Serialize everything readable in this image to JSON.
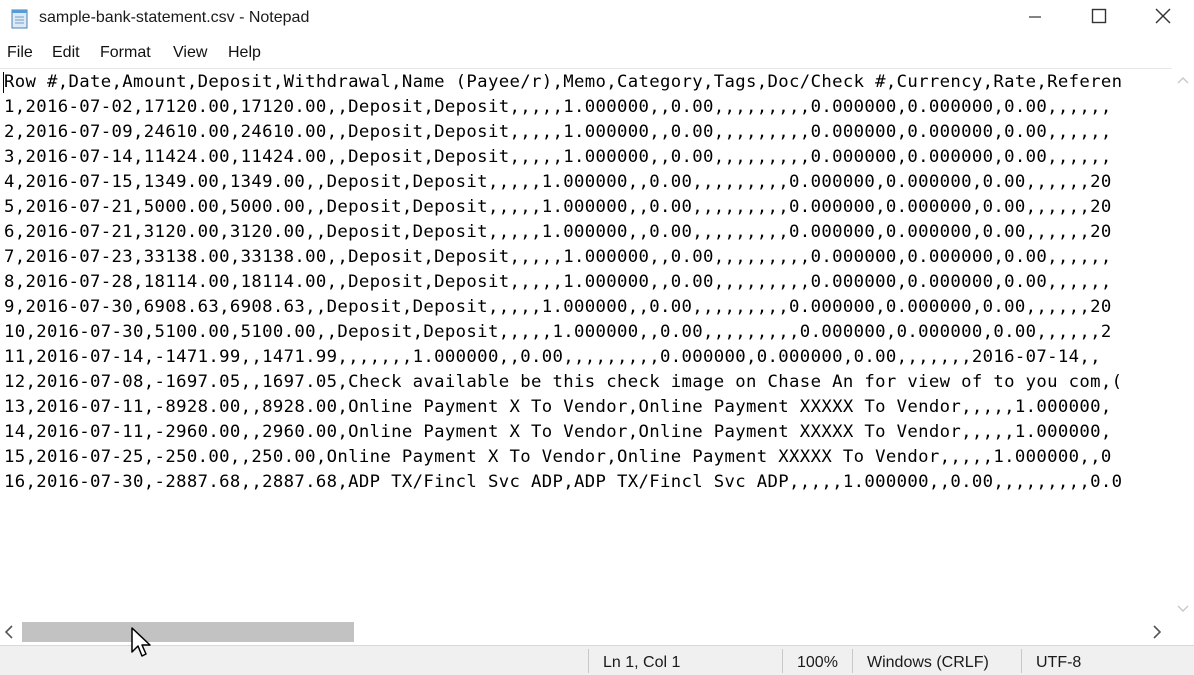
{
  "window": {
    "title": "sample-bank-statement.csv - Notepad",
    "app_icon": "notepad-icon",
    "controls": {
      "minimize": "minimize-icon",
      "maximize": "maximize-icon",
      "close": "close-icon"
    }
  },
  "menu": [
    "File",
    "Edit",
    "Format",
    "View",
    "Help"
  ],
  "editor": {
    "lines": [
      "Row #,Date,Amount,Deposit,Withdrawal,Name (Payee/r),Memo,Category,Tags,Doc/Check #,Currency,Rate,Referen",
      "1,2016-07-02,17120.00,17120.00,,Deposit,Deposit,,,,,1.000000,,0.00,,,,,,,,,0.000000,0.000000,0.00,,,,,,",
      "2,2016-07-09,24610.00,24610.00,,Deposit,Deposit,,,,,1.000000,,0.00,,,,,,,,,0.000000,0.000000,0.00,,,,,,",
      "3,2016-07-14,11424.00,11424.00,,Deposit,Deposit,,,,,1.000000,,0.00,,,,,,,,,0.000000,0.000000,0.00,,,,,,",
      "4,2016-07-15,1349.00,1349.00,,Deposit,Deposit,,,,,1.000000,,0.00,,,,,,,,,0.000000,0.000000,0.00,,,,,,20",
      "5,2016-07-21,5000.00,5000.00,,Deposit,Deposit,,,,,1.000000,,0.00,,,,,,,,,0.000000,0.000000,0.00,,,,,,20",
      "6,2016-07-21,3120.00,3120.00,,Deposit,Deposit,,,,,1.000000,,0.00,,,,,,,,,0.000000,0.000000,0.00,,,,,,20",
      "7,2016-07-23,33138.00,33138.00,,Deposit,Deposit,,,,,1.000000,,0.00,,,,,,,,,0.000000,0.000000,0.00,,,,,,",
      "8,2016-07-28,18114.00,18114.00,,Deposit,Deposit,,,,,1.000000,,0.00,,,,,,,,,0.000000,0.000000,0.00,,,,,,",
      "9,2016-07-30,6908.63,6908.63,,Deposit,Deposit,,,,,1.000000,,0.00,,,,,,,,,0.000000,0.000000,0.00,,,,,,20",
      "10,2016-07-30,5100.00,5100.00,,Deposit,Deposit,,,,,1.000000,,0.00,,,,,,,,,0.000000,0.000000,0.00,,,,,,2",
      "11,2016-07-14,-1471.99,,1471.99,,,,,,,1.000000,,0.00,,,,,,,,,0.000000,0.000000,0.00,,,,,,,2016-07-14,,",
      "12,2016-07-08,-1697.05,,1697.05,Check available be this check image on Chase An for view of to you com,(",
      "13,2016-07-11,-8928.00,,8928.00,Online Payment X To Vendor,Online Payment XXXXX To Vendor,,,,,1.000000,",
      "14,2016-07-11,-2960.00,,2960.00,Online Payment X To Vendor,Online Payment XXXXX To Vendor,,,,,1.000000,",
      "15,2016-07-25,-250.00,,250.00,Online Payment X To Vendor,Online Payment XXXXX To Vendor,,,,,1.000000,,0",
      "16,2016-07-30,-2887.68,,2887.68,ADP TX/Fincl Svc ADP,ADP TX/Fincl Svc ADP,,,,,1.000000,,0.00,,,,,,,,,0.0"
    ]
  },
  "status": {
    "position": "Ln 1, Col 1",
    "zoom": "100%",
    "line_endings": "Windows (CRLF)",
    "encoding": "UTF-8"
  }
}
